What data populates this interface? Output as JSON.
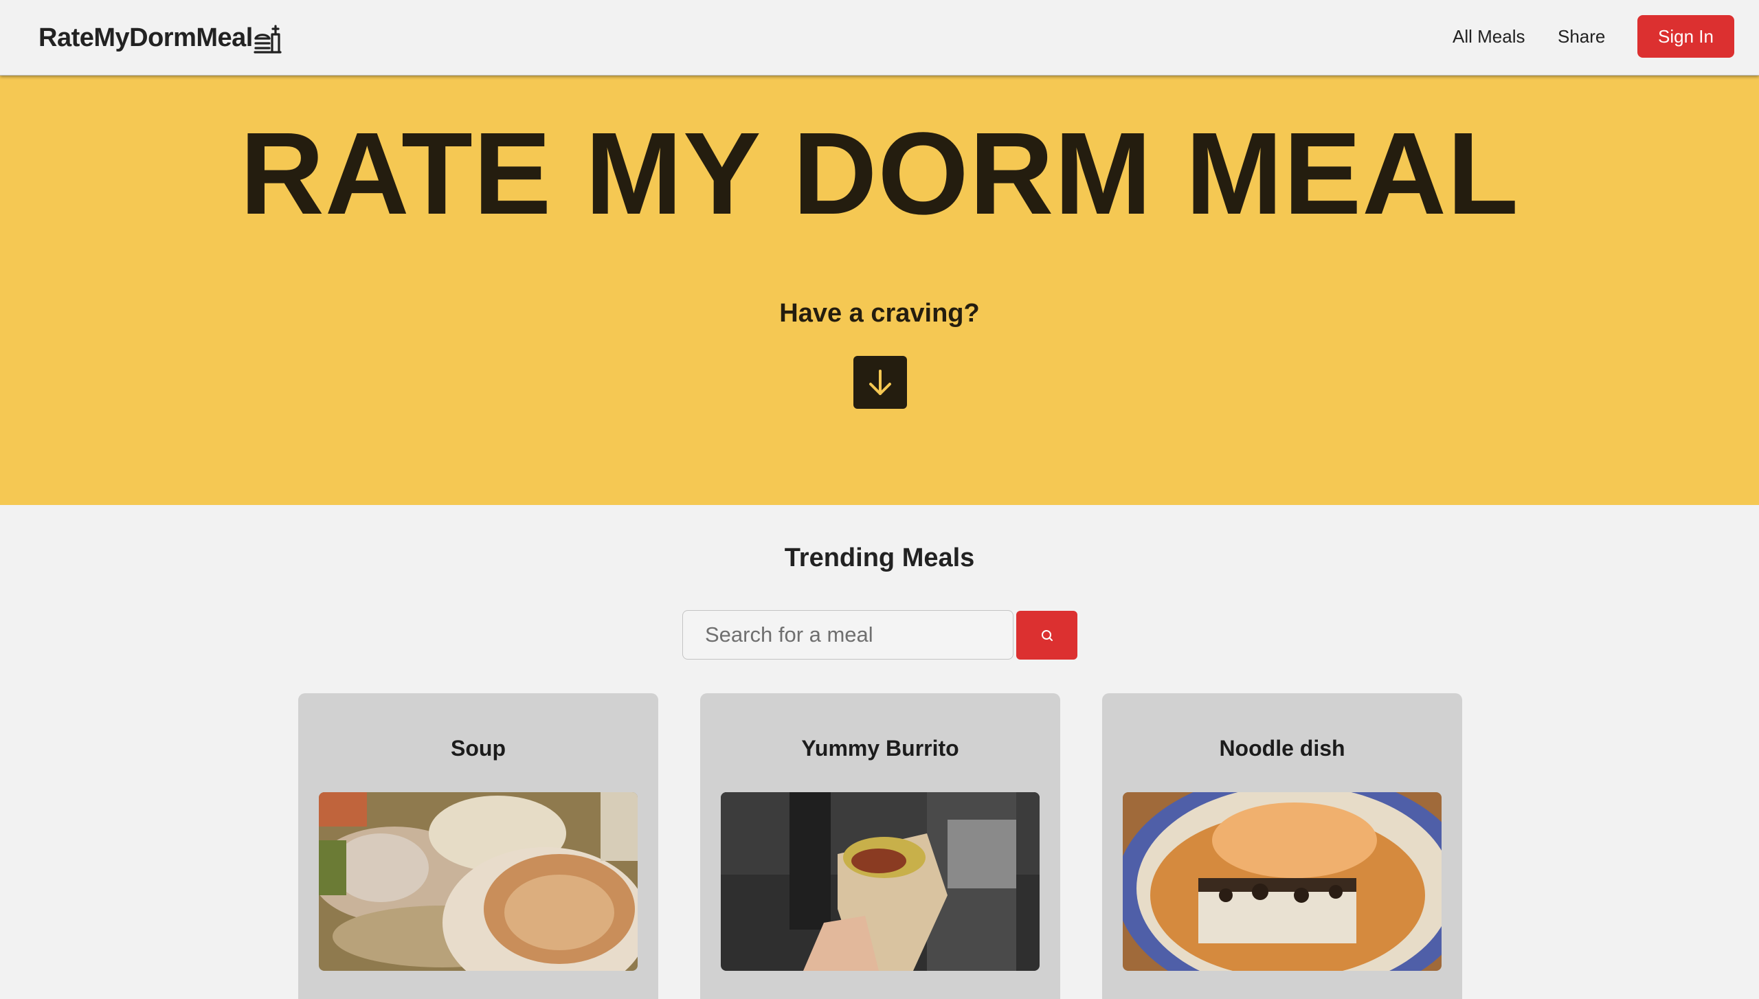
{
  "nav": {
    "brand": "RateMyDormMeal",
    "brand_icon": "food-bowl-icon",
    "links": [
      "All Meals",
      "Share"
    ],
    "signin_label": "Sign In"
  },
  "hero": {
    "title": "RATE MY DORM MEAL",
    "subtitle": "Have a craving?",
    "scroll_icon": "arrow-down-icon"
  },
  "trending": {
    "title": "Trending Meals",
    "search_placeholder": "Search for a meal",
    "search_icon": "search-icon"
  },
  "meals": [
    {
      "name": "Soup"
    },
    {
      "name": "Yummy Burrito"
    },
    {
      "name": "Noodle dish"
    }
  ],
  "colors": {
    "accent": "#dc3030",
    "hero_bg": "#f5c853",
    "dark": "#241d0f",
    "page_bg": "#f2f2f2",
    "card_bg": "#d1d1d1"
  }
}
